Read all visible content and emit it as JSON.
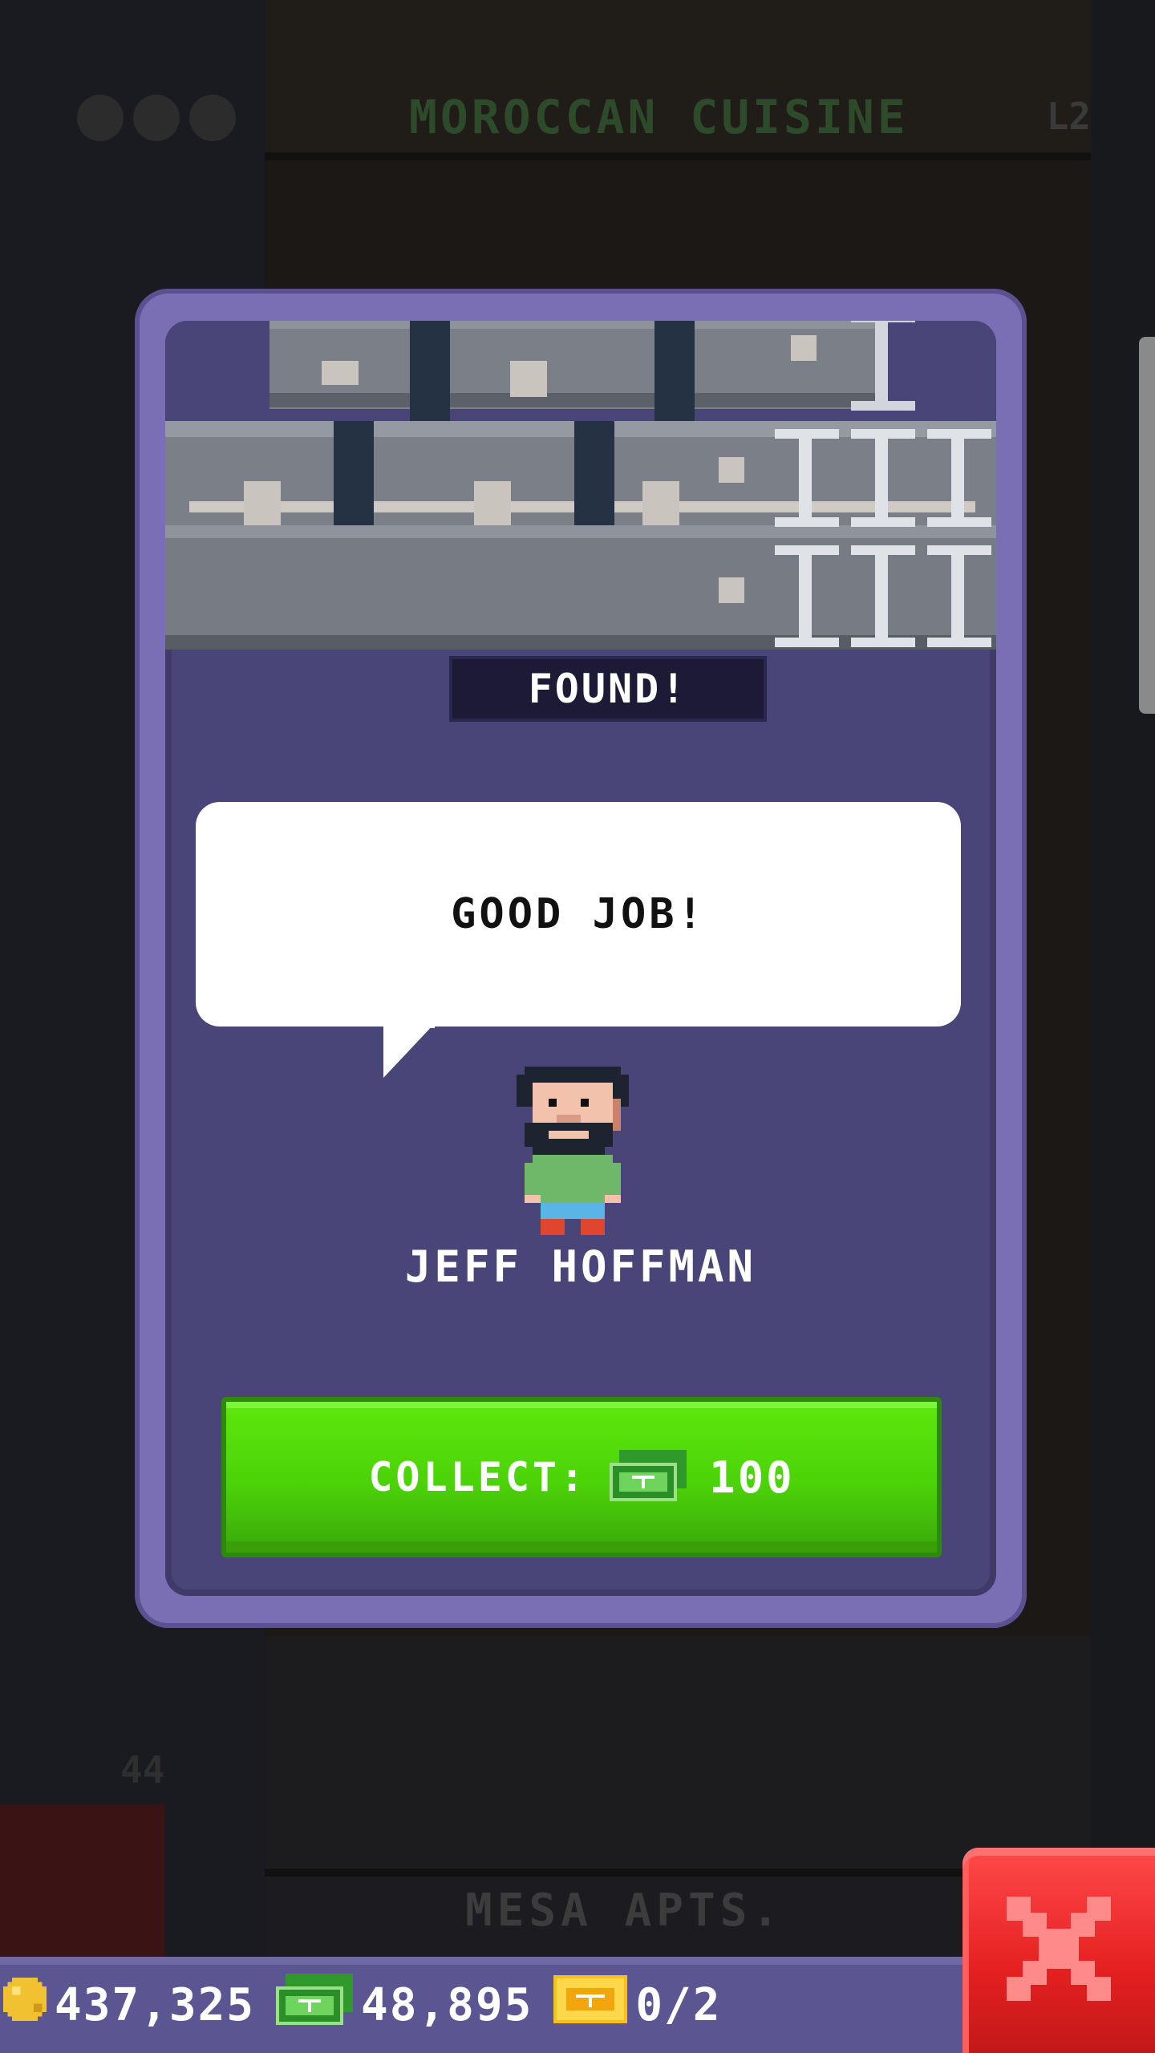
{
  "background": {
    "floor_top_title": "MOROCCAN CUISINE",
    "floor_top_level": "L2",
    "floor_bottom_title": "MESA APTS.",
    "floor_number": "44"
  },
  "modal": {
    "found_label": "FOUND!",
    "speech_text": "GOOD JOB!",
    "npc_name": "JEFF HOFFMAN",
    "collect_label": "COLLECT:",
    "collect_amount": "100",
    "collect_currency_icon": "tower-bux-icon"
  },
  "status_bar": {
    "coins": "437,325",
    "tower_bux": "48,895",
    "vip_tickets": "0/2",
    "coin_icon": "coin-icon",
    "bux_icon": "tower-bux-icon",
    "ticket_icon": "vip-ticket-icon"
  },
  "close_button": {
    "icon": "close-icon"
  },
  "colors": {
    "card_border": "#7a6fb4",
    "card_fill": "#4a4579",
    "collect_green": "#4bd209",
    "close_red": "#e52020",
    "status_bar": "#5b5692"
  }
}
